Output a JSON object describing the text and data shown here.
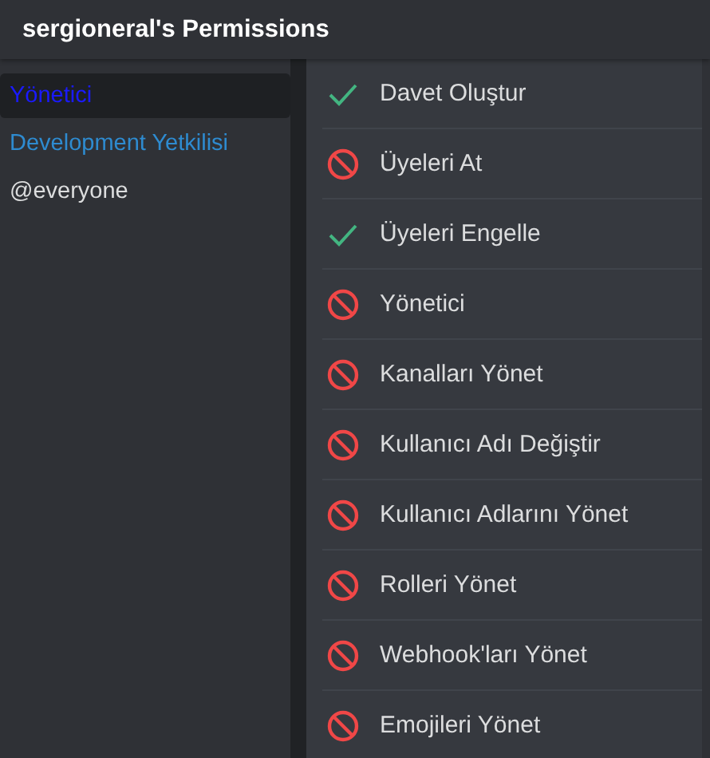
{
  "window": {
    "title": "sergioneral's Permissions"
  },
  "roles": [
    {
      "name": "Yönetici",
      "color": "#1a1aff",
      "selected": true
    },
    {
      "name": "Development Yetkilisi",
      "color": "#2e8bd0",
      "selected": false
    },
    {
      "name": "@everyone",
      "color": "#dcddde",
      "selected": false
    }
  ],
  "permissions": [
    {
      "label": "Davet Oluştur",
      "allowed": true
    },
    {
      "label": "Üyeleri At",
      "allowed": false
    },
    {
      "label": "Üyeleri Engelle",
      "allowed": true
    },
    {
      "label": "Yönetici",
      "allowed": false
    },
    {
      "label": "Kanalları Yönet",
      "allowed": false
    },
    {
      "label": "Kullanıcı Adı Değiştir",
      "allowed": false
    },
    {
      "label": "Kullanıcı Adlarını Yönet",
      "allowed": false
    },
    {
      "label": "Rolleri Yönet",
      "allowed": false
    },
    {
      "label": "Webhook'ları Yönet",
      "allowed": false
    },
    {
      "label": "Emojileri Yönet",
      "allowed": false
    }
  ]
}
